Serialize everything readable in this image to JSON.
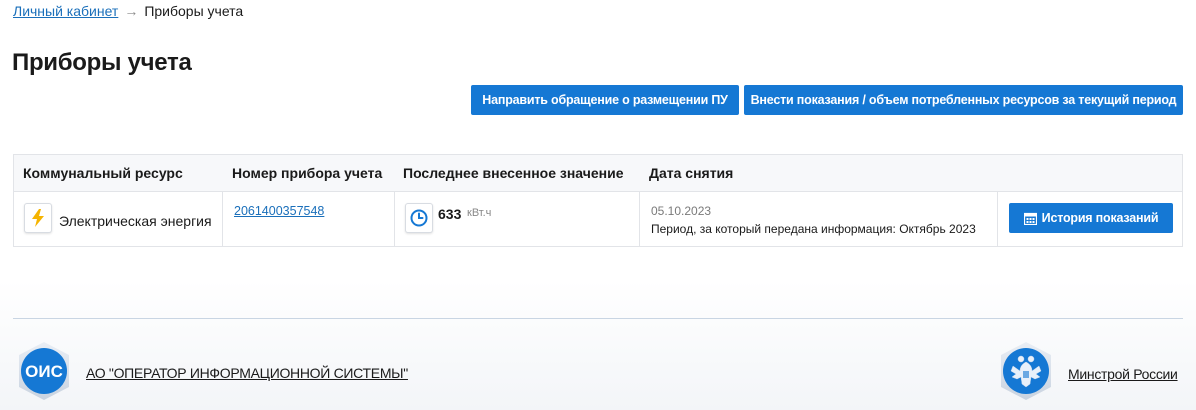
{
  "breadcrumb": {
    "home_label": "Личный кабинет",
    "separator": "→",
    "current_label": "Приборы учета"
  },
  "page": {
    "title": "Приборы учета"
  },
  "actions": {
    "submit_request_label": "Направить обращение о размещении ПУ",
    "enter_readings_label": "Внести показания / объем потребленных ресурсов за текущий период"
  },
  "table": {
    "headers": [
      "Коммунальный ресурс",
      "Номер прибора учета",
      "Последнее внесенное значение",
      "Дата снятия"
    ],
    "rows": [
      {
        "resource_icon": "lightning-icon",
        "resource": "Электрическая энергия",
        "meter_number": "2061400357548",
        "reading_icon": "clock-icon",
        "reading_value": "633",
        "reading_unit": "кВт.ч",
        "date": "05.10.2023",
        "period": "Период, за который передана информация: Октябрь 2023",
        "history_label": "История показаний",
        "history_icon": "calendar-icon"
      }
    ]
  },
  "footer": {
    "operator_logo_text": "ОИС",
    "operator_label": "АО \"ОПЕРАТОР ИНФОРМАЦИОННОЙ СИСТЕМЫ\"",
    "ministry_label": "Минстрой России",
    "ministry_logo_icon": "eagle-emblem-icon"
  },
  "colors": {
    "accent": "#1578d4",
    "link": "#1a6fba",
    "lightning": "#f5b400"
  }
}
